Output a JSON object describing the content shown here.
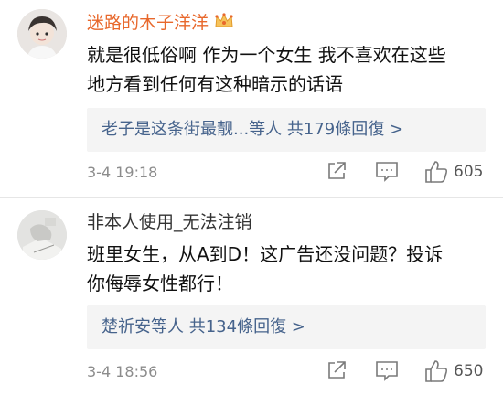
{
  "comments": [
    {
      "username": "迷路的木子洋洋",
      "badge_icon": "crown-icon",
      "text_lines": [
        "就是很低俗啊 作为一个女生 我不喜欢在这些",
        "地方看到任何有这种暗示的话语"
      ],
      "reply_summary": "老子是这条街最靓...等人 共179條回復 >",
      "timestamp": "3-4 19:18",
      "likes": "605"
    },
    {
      "username": "非本人使用_无法注销",
      "text_lines": [
        "班里女生，从A到D！这广告还没问题？投诉",
        "你侮辱女性都行！"
      ],
      "reply_summary": "楚祈安等人 共134條回復 >",
      "timestamp": "3-4 18:56",
      "likes": "650"
    }
  ],
  "colors": {
    "vip_name": "#e8682c",
    "normal_name": "#333333",
    "reply_link": "#46638c",
    "reply_bg": "#f4f4f4",
    "meta_gray": "#8c8c8c"
  }
}
